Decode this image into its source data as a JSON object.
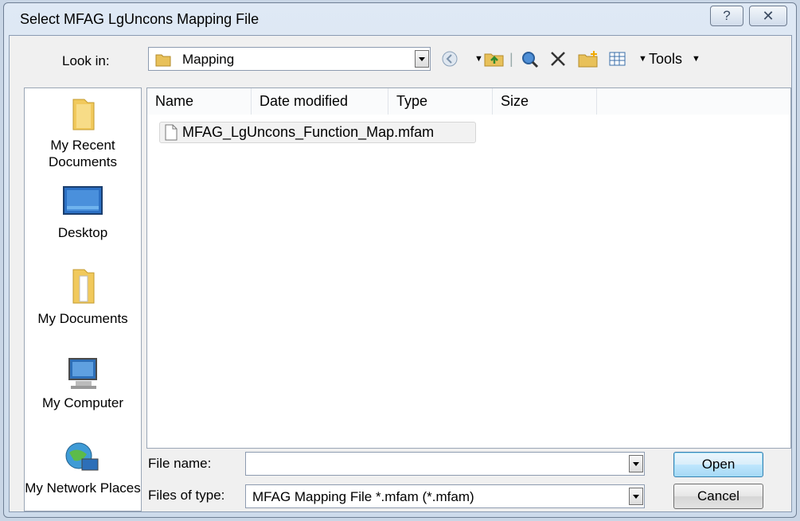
{
  "window": {
    "title": "Select MFAG LgUncons Mapping File",
    "help_glyph": "?",
    "close_glyph": "⊠"
  },
  "toolbar": {
    "look_in_label": "Look in:",
    "look_in_value": "Mapping",
    "tools_label": "Tools"
  },
  "places": [
    {
      "label": "My Recent Documents",
      "icon": "recent-documents-icon"
    },
    {
      "label": "Desktop",
      "icon": "desktop-icon"
    },
    {
      "label": "My Documents",
      "icon": "my-documents-icon"
    },
    {
      "label": "My Computer",
      "icon": "my-computer-icon"
    },
    {
      "label": "My Network Places",
      "icon": "network-places-icon"
    }
  ],
  "columns": [
    "Name",
    "Date modified",
    "Type",
    "Size"
  ],
  "files": [
    {
      "name": "MFAG_LgUncons_Function_Map.mfam"
    }
  ],
  "bottom": {
    "file_name_label": "File name:",
    "file_name_value": "",
    "file_type_label": "Files of type:",
    "file_type_value": "MFAG Mapping File *.mfam (*.mfam)",
    "open_label": "Open",
    "cancel_label": "Cancel"
  }
}
